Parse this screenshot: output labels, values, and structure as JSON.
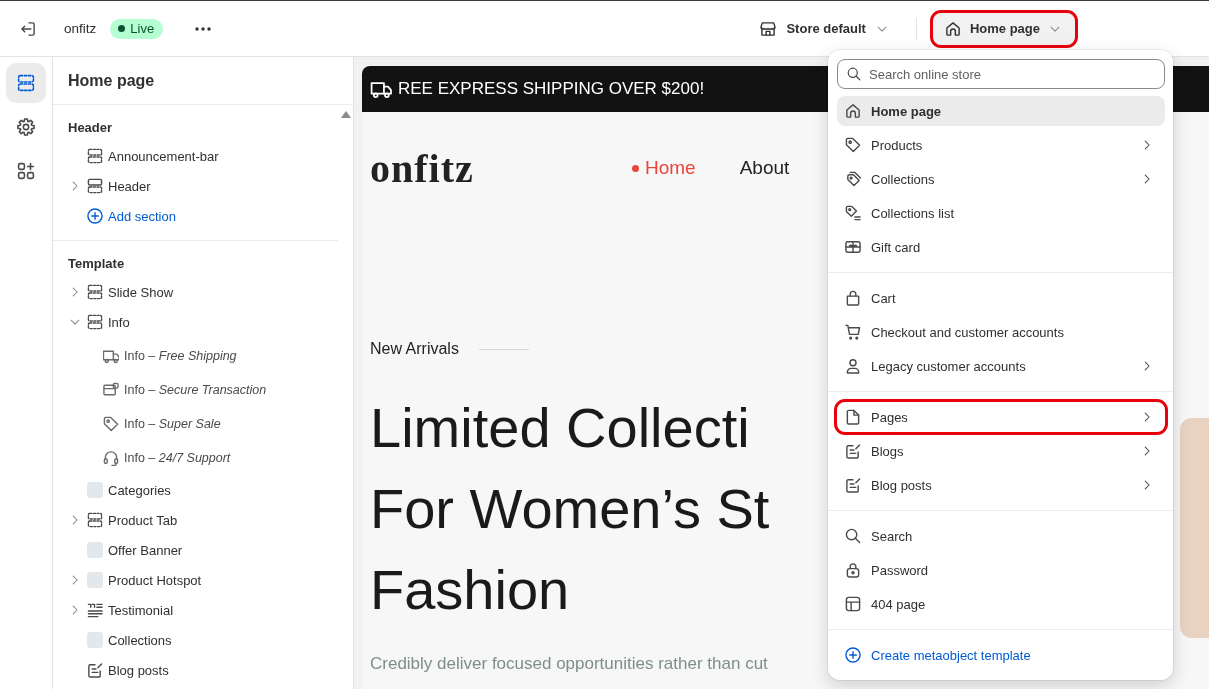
{
  "top_bar": {
    "store_name": "onfitz",
    "status": "Live",
    "theme_selector": "Store default",
    "page_selector": {
      "label": "Home page",
      "highlighted": true
    }
  },
  "rail": [
    {
      "kind": "sections",
      "selected": true
    },
    {
      "kind": "settings",
      "selected": false
    },
    {
      "kind": "apps",
      "selected": false
    }
  ],
  "sidebar": {
    "title": "Home page",
    "groups": [
      {
        "heading": "Header",
        "items": [
          {
            "label": "Announcement-bar",
            "kind": "section"
          },
          {
            "label": "Header",
            "kind": "header",
            "expanded": false
          }
        ],
        "add_label": "Add section"
      },
      {
        "heading": "Template",
        "items": [
          {
            "label": "Slide Show",
            "kind": "section",
            "expanded": false
          },
          {
            "label": "Info",
            "kind": "section",
            "expanded": true,
            "children": [
              {
                "label": "Info – *Free Shipping*",
                "kind": "shipping"
              },
              {
                "label": "Info – *Secure Transaction*",
                "kind": "payment"
              },
              {
                "label": "Info – *Super Sale*",
                "kind": "sale"
              },
              {
                "label": "Info – *24/7 Support*",
                "kind": "support"
              }
            ]
          },
          {
            "label": "Categories",
            "kind": "thumbnail"
          },
          {
            "label": "Product Tab",
            "kind": "section",
            "expanded": false
          },
          {
            "label": "Offer Banner",
            "kind": "thumbnail"
          },
          {
            "label": "Product Hotspot",
            "kind": "thumbnail",
            "expanded": false
          },
          {
            "label": "Testimonial",
            "kind": "testimonial",
            "expanded": false
          },
          {
            "label": "Collections",
            "kind": "thumbnail"
          },
          {
            "label": "Blog posts",
            "kind": "blog"
          }
        ]
      }
    ]
  },
  "page_menu": {
    "search": {
      "placeholder": "Search online store"
    },
    "groups": [
      {
        "items": [
          {
            "label": "Home page",
            "kind": "home",
            "selected": true,
            "submenu": false,
            "highlighted": false
          },
          {
            "label": "Products",
            "kind": "product",
            "selected": false,
            "submenu": true,
            "highlighted": false
          },
          {
            "label": "Collections",
            "kind": "collection",
            "selected": false,
            "submenu": true,
            "highlighted": false
          },
          {
            "label": "Collections list",
            "kind": "collectionlist",
            "selected": false,
            "submenu": false,
            "highlighted": false
          },
          {
            "label": "Gift card",
            "kind": "giftcard",
            "selected": false,
            "submenu": false,
            "highlighted": false
          }
        ]
      },
      {
        "items": [
          {
            "label": "Cart",
            "kind": "cart",
            "selected": false,
            "submenu": false,
            "highlighted": false
          },
          {
            "label": "Checkout and customer accounts",
            "kind": "checkout",
            "selected": false,
            "submenu": false,
            "highlighted": false
          },
          {
            "label": "Legacy customer accounts",
            "kind": "account",
            "selected": false,
            "submenu": true,
            "highlighted": false
          }
        ]
      },
      {
        "items": [
          {
            "label": "Pages",
            "kind": "page",
            "selected": false,
            "submenu": true,
            "highlighted": true
          },
          {
            "label": "Blogs",
            "kind": "blog",
            "selected": false,
            "submenu": true,
            "highlighted": false
          },
          {
            "label": "Blog posts",
            "kind": "post",
            "selected": false,
            "submenu": true,
            "highlighted": false
          }
        ]
      },
      {
        "items": [
          {
            "label": "Search",
            "kind": "search",
            "selected": false,
            "submenu": false,
            "highlighted": false
          },
          {
            "label": "Password",
            "kind": "password",
            "selected": false,
            "submenu": false,
            "highlighted": false
          },
          {
            "label": "404 page",
            "kind": "notfound",
            "selected": false,
            "submenu": false,
            "highlighted": false
          }
        ]
      }
    ],
    "action": "Create metaobject template"
  },
  "preview": {
    "announcement": "REE EXPRESS SHIPPING OVER $200!",
    "logo": "onfitz",
    "nav": [
      {
        "label": "Home",
        "selected": true
      },
      {
        "label": "About",
        "selected": false
      }
    ],
    "eyebrow": "New Arrivals",
    "heading_lines": [
      "Limited Collecti",
      "For Women’s St",
      "Fashion"
    ],
    "paragraph": "Credibly deliver focused opportunities rather than cut"
  }
}
